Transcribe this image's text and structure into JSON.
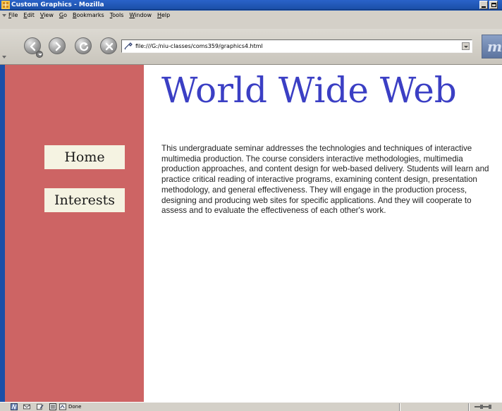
{
  "window": {
    "title": "Custom Graphics - Mozilla"
  },
  "menu": {
    "items": [
      "File",
      "Edit",
      "View",
      "Go",
      "Bookmarks",
      "Tools",
      "Window",
      "Help"
    ]
  },
  "navigation": {
    "url": "file:///G:/niu-classes/coms359/graphics4.html",
    "icons": [
      "back-icon",
      "forward-icon",
      "reload-icon",
      "stop-icon",
      "mozilla-logo-icon"
    ]
  },
  "sidebar": {
    "links": [
      {
        "label": "Home"
      },
      {
        "label": "Interests"
      }
    ],
    "background": "#cd6464"
  },
  "page": {
    "heading": "World Wide Web",
    "body": "This undergraduate seminar addresses the technologies and techniques of interactive multimedia production. The course considers interactive methodologies, multimedia production approaches, and content design for web-based delivery. Students will learn and practice critical reading of interactive programs, examining content design, presentation methodology, and general effectiveness. They will engage in the production process, designing and producing web sites for specific applications. And they will cooperate to assess and to evaluate the effectiveness of each other's work.",
    "heading_color": "#3b3fc4"
  },
  "status": {
    "text": "Done"
  }
}
